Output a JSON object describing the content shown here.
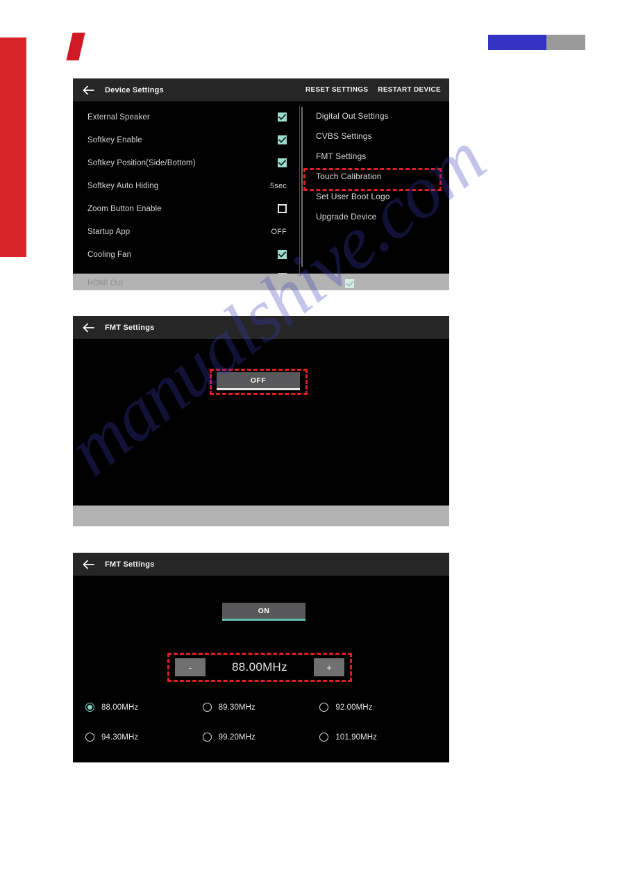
{
  "page": {
    "watermark_text": "manualshive.com",
    "accent_red": "#d8232a",
    "accent_blue": "#3333c4",
    "accent_gray": "#9a9a9a",
    "highlight_red": "#e02020",
    "checkbox_teal": "#9ddbcd"
  },
  "device_settings": {
    "title": "Device Settings",
    "back_icon": "back-arrow-icon",
    "actions": [
      {
        "label": "RESET SETTINGS"
      },
      {
        "label": "RESTART DEVICE"
      }
    ],
    "left_rows": [
      {
        "label": "External Speaker",
        "type": "checkbox",
        "value": "checked"
      },
      {
        "label": "Softkey Enable",
        "type": "checkbox",
        "value": "checked"
      },
      {
        "label": "Softkey Position(Side/Bottom)",
        "type": "checkbox",
        "value": "checked"
      },
      {
        "label": "Softkey Auto Hiding",
        "type": "text",
        "value": "5sec"
      },
      {
        "label": "Zoom Button Enable",
        "type": "checkbox",
        "value": "unchecked"
      },
      {
        "label": "Startup App",
        "type": "text",
        "value": "OFF"
      },
      {
        "label": "Cooling Fan",
        "type": "checkbox",
        "value": "checked"
      }
    ],
    "disabled_row": {
      "label": "HDMI Out",
      "type": "checkbox",
      "value": "checked"
    },
    "menu_items": [
      {
        "label": "Digital Out Settings",
        "highlighted": false
      },
      {
        "label": "CVBS Settings",
        "highlighted": false
      },
      {
        "label": "FMT Settings",
        "highlighted": true
      },
      {
        "label": "Touch Calibration",
        "highlighted": false
      },
      {
        "label": "Set User Boot Logo",
        "highlighted": false
      },
      {
        "label": "Upgrade Device",
        "highlighted": false
      }
    ]
  },
  "fmt_off": {
    "title": "FMT Settings",
    "back_icon": "back-arrow-icon",
    "toggle_label": "OFF"
  },
  "fmt_on": {
    "title": "FMT Settings",
    "back_icon": "back-arrow-icon",
    "toggle_label": "ON",
    "stepper": {
      "minus_label": "-",
      "plus_label": "+",
      "frequency": "88.00MHz"
    },
    "presets": [
      {
        "label": "88.00MHz",
        "selected": true
      },
      {
        "label": "89.30MHz",
        "selected": false
      },
      {
        "label": "92.00MHz",
        "selected": false
      },
      {
        "label": "94.30MHz",
        "selected": false
      },
      {
        "label": "99.20MHz",
        "selected": false
      },
      {
        "label": "101.90MHz",
        "selected": false
      }
    ]
  }
}
